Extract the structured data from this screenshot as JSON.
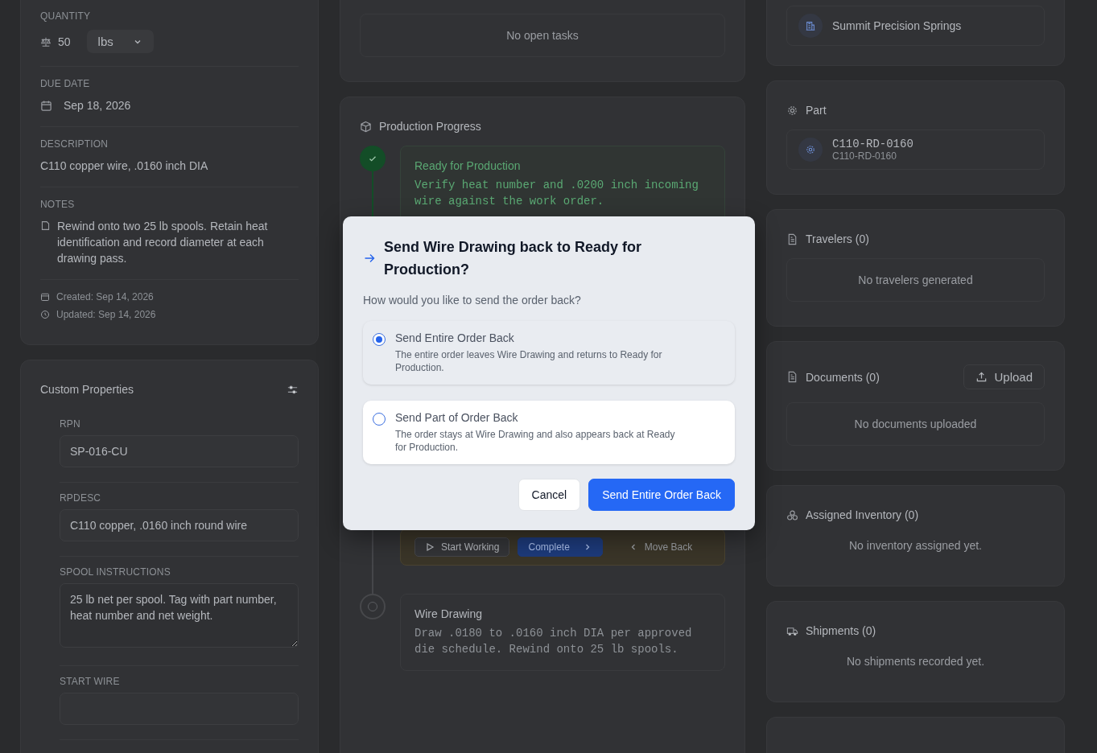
{
  "details": {
    "quantity": {
      "label": "QUANTITY",
      "value": "50",
      "unit": "lbs"
    },
    "due_date": {
      "label": "DUE DATE",
      "value": "Sep 18, 2026"
    },
    "description": {
      "label": "DESCRIPTION",
      "value": "C110 copper wire, .0160 inch DIA"
    },
    "notes": {
      "label": "NOTES",
      "value": "Rewind onto two 25 lb spools. Retain heat identification and record diameter at each drawing pass."
    },
    "created": "Created: Sep 14, 2026",
    "updated": "Updated: Sep 14, 2026"
  },
  "custom_properties": {
    "title": "Custom Properties",
    "fields": [
      {
        "label": "RPN",
        "value": "SP-016-CU",
        "kind": "input"
      },
      {
        "label": "RPDESC",
        "value": "C110 copper, .0160 inch round wire",
        "kind": "input"
      },
      {
        "label": "SPOOL INSTRUCTIONS",
        "value": "25 lb net per spool. Tag with part number, heat number and net weight.",
        "kind": "textarea"
      },
      {
        "label": "START WIRE",
        "kind": "input"
      }
    ]
  },
  "tasks": {
    "empty_text": "No open tasks"
  },
  "production_progress": {
    "title": "Production Progress",
    "steps": [
      {
        "kind": "completed",
        "name": "Ready for Production",
        "instructions": "Verify heat number and .0200 inch incoming wire against the work order."
      },
      {
        "kind": "current",
        "actions": [
          {
            "kind": "start",
            "label": "Start Working"
          },
          {
            "kind": "complete",
            "label": "Complete"
          },
          {
            "kind": "back",
            "label": "Move Back"
          }
        ]
      },
      {
        "kind": "pending",
        "name": "Wire Drawing",
        "instructions": "Draw .0180 to .0160 inch DIA per approved die schedule. Rewind onto 25 lb spools."
      }
    ]
  },
  "customer": {
    "name": "Summit Precision Springs"
  },
  "part": {
    "title": "Part",
    "number": "C110-RD-0160",
    "subtitle": "C110-RD-0160"
  },
  "panels": [
    {
      "kind": "travelers",
      "title": "Travelers (0)",
      "empty_text": "No travelers generated",
      "boxed": true
    },
    {
      "kind": "documents",
      "title": "Documents (0)",
      "empty_text": "No documents uploaded",
      "boxed": true,
      "action": "Upload"
    },
    {
      "kind": "inventory",
      "title": "Assigned Inventory (0)",
      "empty_text": "No inventory assigned yet.",
      "boxed": false
    },
    {
      "kind": "shipments",
      "title": "Shipments (0)",
      "empty_text": "No shipments recorded yet.",
      "boxed": false
    }
  ],
  "dialog": {
    "title": "Send Wire Drawing back to Ready for Production?",
    "prompt": "How would you like to send the order back?",
    "options": [
      {
        "label": "Send Entire Order Back",
        "description": "The entire order leaves Wire Drawing and returns to Ready for Production.",
        "selected": true
      },
      {
        "label": "Send Part of Order Back",
        "description": "The order stays at Wire Drawing and also appears back at Ready for Production.",
        "selected": false
      }
    ],
    "buttons": [
      {
        "label": "Cancel",
        "kind": "secondary"
      },
      {
        "label": "Send Entire Order Back",
        "kind": "primary"
      }
    ]
  }
}
